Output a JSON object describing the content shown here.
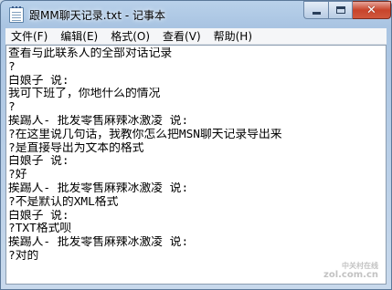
{
  "window": {
    "title": "跟MM聊天记录.txt - 记事本"
  },
  "menu": {
    "items": [
      {
        "name": "file",
        "label": "文件(F)"
      },
      {
        "name": "edit",
        "label": "编辑(E)"
      },
      {
        "name": "format",
        "label": "格式(O)"
      },
      {
        "name": "view",
        "label": "查看(V)"
      },
      {
        "name": "help",
        "label": "帮助(H)"
      }
    ]
  },
  "document": {
    "lines": [
      "查看与此联系人的全部对话记录",
      "?",
      "白娘子 说:",
      "我可下班了，你地什么的情况",
      "?",
      "挨踢人- 批发零售麻辣冰激凌 说:",
      "?在这里说几句话，我教你怎么把MSN聊天记录导出来",
      "?是直接导出为文本的格式",
      "白娘子 说:",
      "?好",
      "挨踢人- 批发零售麻辣冰激凌 说:",
      "?不是默认的XML格式",
      "白娘子 说:",
      "?TXT格式呗",
      "挨踢人- 批发零售麻辣冰激凌 说:",
      "?对的"
    ]
  },
  "watermark": {
    "cn": "中关村在线",
    "en": "zol.com.cn"
  },
  "icons": {
    "app": "notepad-icon",
    "minimize": "minimize-icon",
    "maximize": "maximize-icon",
    "close": "close-icon"
  }
}
